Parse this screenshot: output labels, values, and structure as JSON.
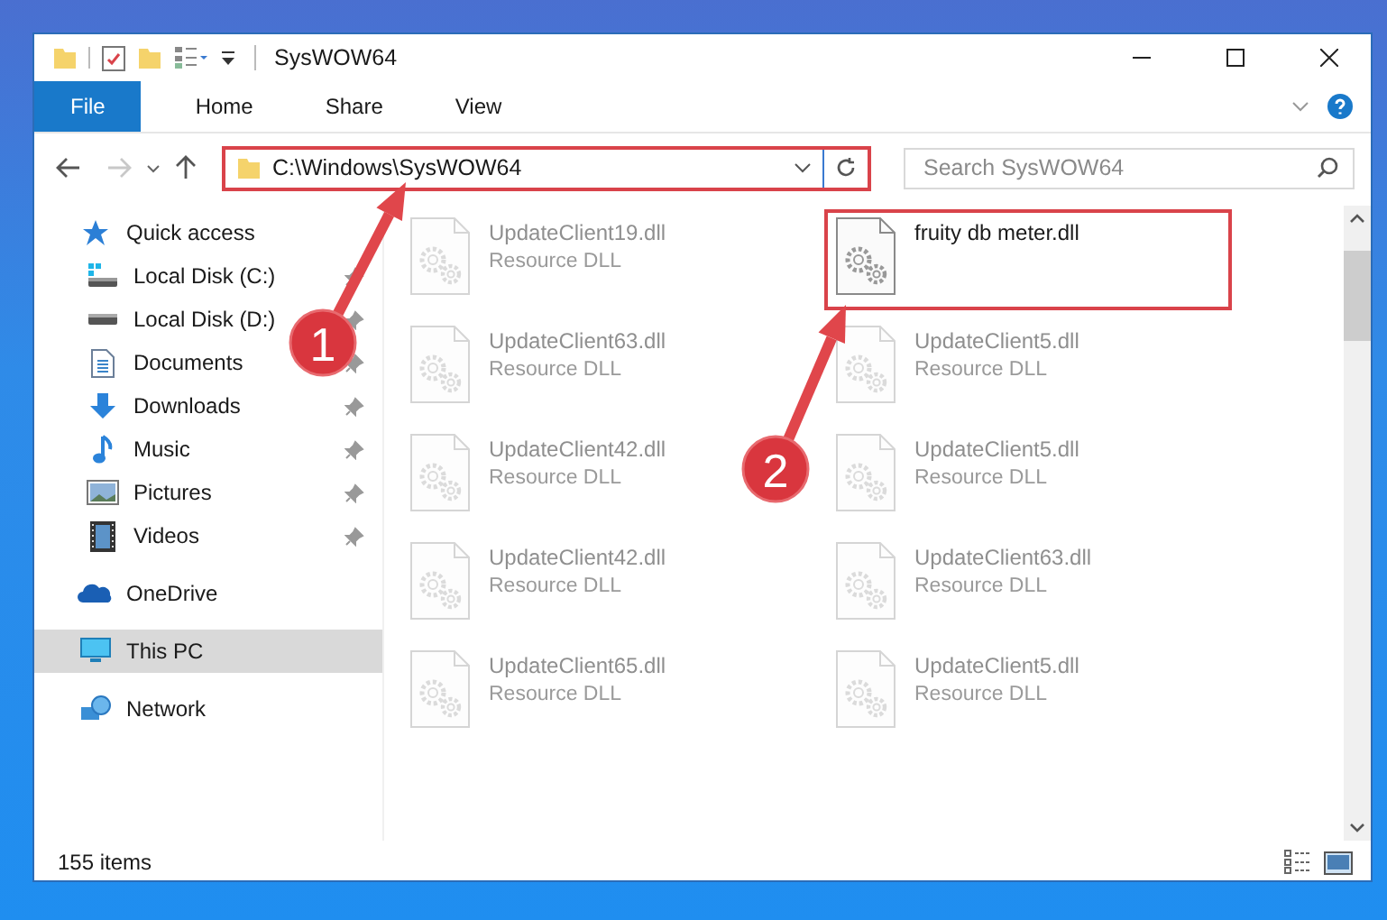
{
  "window": {
    "title": "SysWOW64"
  },
  "ribbon_tabs": [
    {
      "label": "File",
      "selected": true
    },
    {
      "label": "Home",
      "selected": false
    },
    {
      "label": "Share",
      "selected": false
    },
    {
      "label": "View",
      "selected": false
    }
  ],
  "address": {
    "path": "C:\\Windows\\SysWOW64",
    "highlighted": true
  },
  "search": {
    "placeholder": "Search SysWOW64"
  },
  "sidebar": {
    "items": [
      {
        "label": "Quick access",
        "kind": "star",
        "selected": false,
        "children": [
          {
            "label": "Local Disk (C:)",
            "kind": "system-drive",
            "selected": false,
            "pinned": true
          },
          {
            "label": "Local Disk (D:)",
            "kind": "drive",
            "selected": false,
            "pinned": true
          },
          {
            "label": "Documents",
            "kind": "documents",
            "selected": false,
            "pinned": true
          },
          {
            "label": "Downloads",
            "kind": "downloads",
            "selected": false,
            "pinned": true
          },
          {
            "label": "Music",
            "kind": "music",
            "selected": false,
            "pinned": true
          },
          {
            "label": "Pictures",
            "kind": "pictures",
            "selected": false,
            "pinned": true
          },
          {
            "label": "Videos",
            "kind": "videos",
            "selected": false,
            "pinned": true
          }
        ]
      },
      {
        "label": "OneDrive",
        "kind": "cloud",
        "selected": false
      },
      {
        "label": "This PC",
        "kind": "pc",
        "selected": true
      },
      {
        "label": "Network",
        "kind": "network",
        "selected": false
      }
    ]
  },
  "files": [
    {
      "name": "UpdateClient19.dll",
      "type": "Resource DLL",
      "faded": true,
      "highlighted": false
    },
    {
      "name": "fruity db meter.dll",
      "faded": false,
      "highlighted": true
    },
    {
      "name": "UpdateClient63.dll",
      "type": "Resource DLL",
      "faded": true,
      "highlighted": false
    },
    {
      "name": "UpdateClient5.dll",
      "type": "Resource DLL",
      "faded": true,
      "highlighted": false
    },
    {
      "name": "UpdateClient42.dll",
      "type": "Resource DLL",
      "faded": true,
      "highlighted": false
    },
    {
      "name": "UpdateClient5.dll",
      "type": "Resource DLL",
      "faded": true,
      "highlighted": false
    },
    {
      "name": "UpdateClient42.dll",
      "type": "Resource DLL",
      "faded": true,
      "highlighted": false
    },
    {
      "name": "UpdateClient63.dll",
      "type": "Resource DLL",
      "faded": true,
      "highlighted": false
    },
    {
      "name": "UpdateClient65.dll",
      "type": "Resource DLL",
      "faded": true,
      "highlighted": false
    },
    {
      "name": "UpdateClient5.dll",
      "type": "Resource DLL",
      "faded": true,
      "highlighted": false
    }
  ],
  "status_bar": {
    "item_count": "155 items"
  },
  "callouts": [
    {
      "number": "1"
    },
    {
      "number": "2"
    }
  ]
}
